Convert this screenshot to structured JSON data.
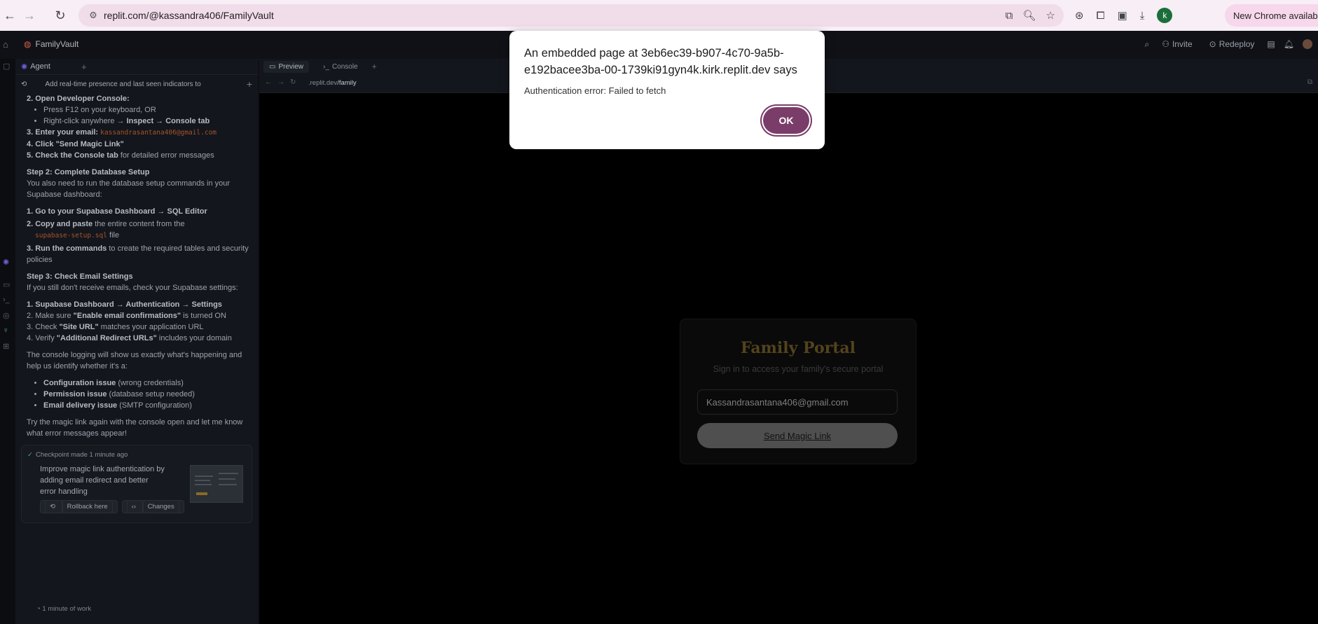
{
  "browser": {
    "url": "replit.com/@kassandra406/FamilyVault",
    "profile_initial": "k",
    "new_chrome_label": "New Chrome available"
  },
  "replit": {
    "project_name": "FamilyVault",
    "invite_label": "Invite",
    "redeploy_label": "Redeploy"
  },
  "agent": {
    "tab_label": "Agent",
    "thread_title": "Add real-time presence and last seen indicators to the ...",
    "lines": {
      "l1": "2. Open Developer Console:",
      "b1": "Press F12 on your keyboard, OR",
      "b2a": "Right-click anywhere → ",
      "b2b": "Inspect → Console tab",
      "l3a": "3. Enter your email: ",
      "l3code": "kassandrasantana406@gmail.com",
      "l4": "4. Click \"Send Magic Link\"",
      "l5a": "5. Check the Console tab",
      "l5b": " for detailed error messages",
      "s2": "Step 2: Complete Database Setup",
      "s2p": "You also need to run the database setup commands in your Supabase dashboard:",
      "d1": "1. Go to your Supabase Dashboard → SQL Editor",
      "d2a": "2. Copy and paste",
      "d2b": " the entire content from the",
      "d2code": "supabase-setup.sql",
      "d2c": " file",
      "d3a": "3. Run the commands",
      "d3b": " to create the required tables and security policies",
      "s3": "Step 3: Check Email Settings",
      "s3p": "If you still don't receive emails, check your Supabase settings:",
      "e1": "1. Supabase Dashboard → Authentication → Settings",
      "e2a": "2. Make sure ",
      "e2b": "\"Enable email confirmations\"",
      "e2c": " is turned ON",
      "e3a": "3. Check ",
      "e3b": "\"Site URL\"",
      "e3c": " matches your application URL",
      "e4a": "4. Verify ",
      "e4b": "\"Additional Redirect URLs\"",
      "e4c": " includes your domain",
      "c1": "The console logging will show us exactly what's happening and help us identify whether it's a:",
      "i1a": "Configuration issue",
      "i1b": " (wrong credentials)",
      "i2a": "Permission issue",
      "i2b": " (database setup needed)",
      "i3a": "Email delivery issue",
      "i3b": " (SMTP configuration)",
      "end": "Try the magic link again with the console open and let me know what error messages appear!"
    },
    "checkpoint": {
      "header": "Checkpoint made 1 minute ago",
      "description": "Improve magic link authentication by adding email redirect and better error handling",
      "rollback_label": "Rollback here",
      "changes_label": "Changes"
    },
    "work_label": "1 minute of work"
  },
  "preview": {
    "tab_preview": "Preview",
    "tab_console": "Console",
    "url_prefix": ".replit.dev",
    "url_path": "/family"
  },
  "portal": {
    "title": "Family Portal",
    "subtitle": "Sign in to access your family's secure portal",
    "email_value": "Kassandrasantana406@gmail.com",
    "button_label": "Send Magic Link"
  },
  "dialog": {
    "title": "An embedded page at 3eb6ec39-b907-4c70-9a5b-e192bacee3ba-00-1739ki91gyn4k.kirk.replit.dev says",
    "message": "Authentication error: Failed to fetch",
    "ok_label": "OK"
  }
}
